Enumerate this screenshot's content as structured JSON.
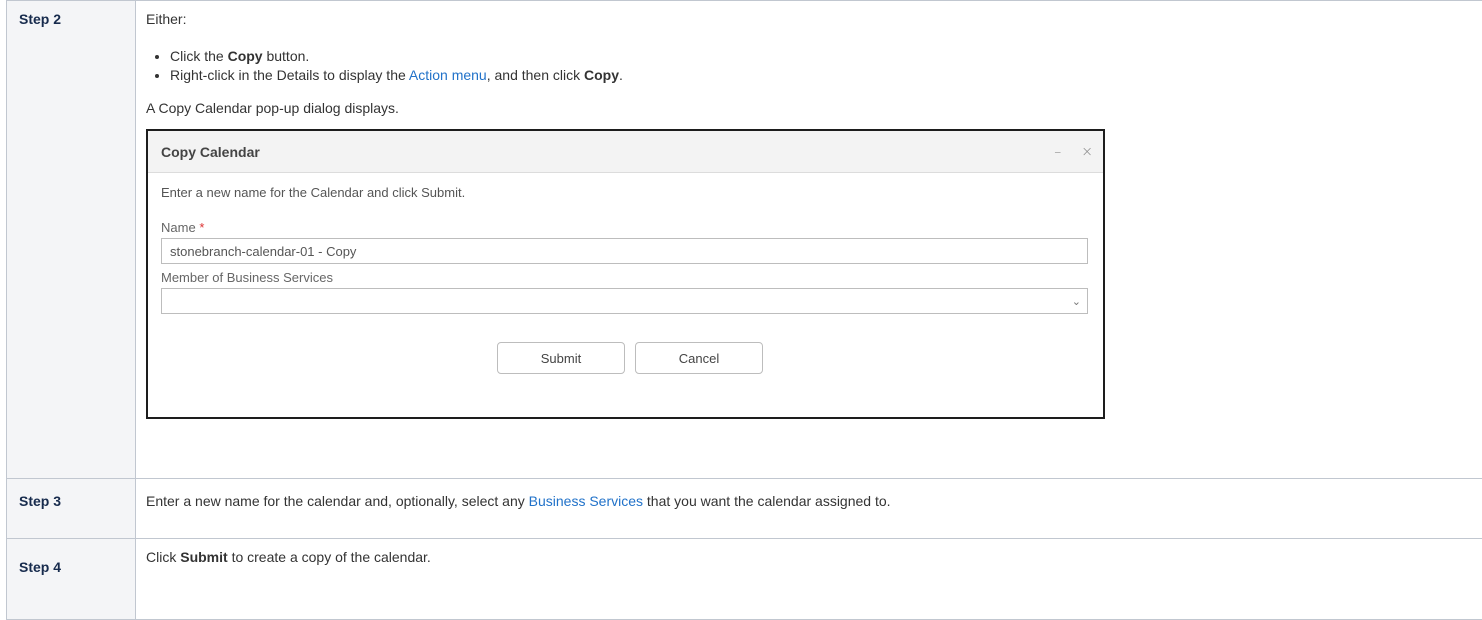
{
  "step2": {
    "label": "Step 2",
    "intro": "Either:",
    "bullet1": {
      "pre": "Click the ",
      "bold": "Copy",
      "post": " button."
    },
    "bullet2": {
      "pre": "Right-click in the Details to display the ",
      "link": "Action menu",
      "mid": ", and then click ",
      "bold": "Copy",
      "post": "."
    },
    "result": "A Copy Calendar pop-up dialog displays."
  },
  "dialog": {
    "title": "Copy Calendar",
    "minimize": "–",
    "close": "×",
    "instruction": "Enter a new name for the Calendar and click Submit.",
    "name_label": "Name",
    "required_mark": "*",
    "name_value": "stonebranch-calendar-01 - Copy",
    "member_label": "Member of Business Services",
    "member_value": "",
    "submit": "Submit",
    "cancel": "Cancel"
  },
  "step3": {
    "label": "Step 3",
    "pre": "Enter a new name for the calendar and, optionally, select any ",
    "link": "Business Services",
    "post": " that you want the calendar assigned to."
  },
  "step4": {
    "label": "Step 4",
    "pre": "Click ",
    "bold": "Submit",
    "post": " to create a copy of the calendar."
  }
}
